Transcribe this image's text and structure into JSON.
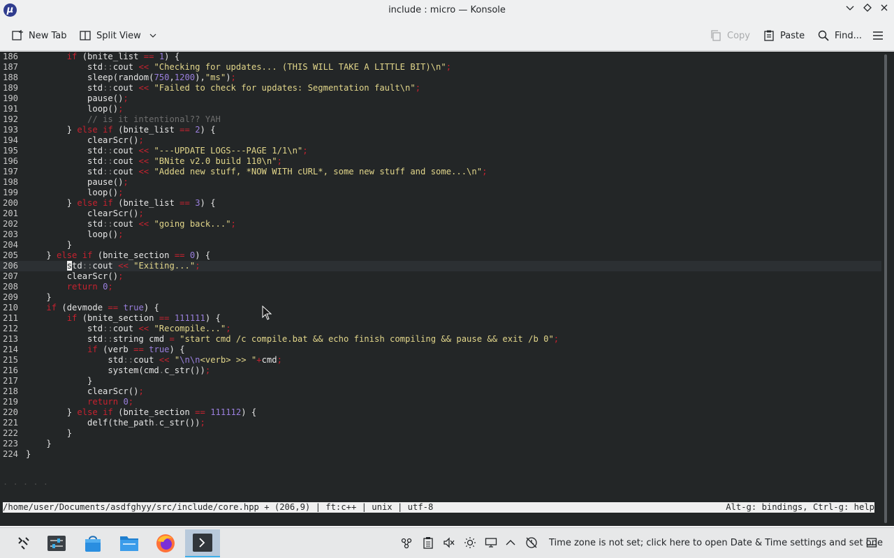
{
  "window": {
    "title": "include : micro — Konsole",
    "app_icon_glyph": "µ",
    "controls": [
      "chevron-down-icon",
      "diamond-icon",
      "close-icon"
    ]
  },
  "toolbar": {
    "new_tab": "New Tab",
    "split_view": "Split View",
    "copy": "Copy",
    "paste": "Paste",
    "find": "Find...",
    "menu_icon": "hamburger-icon"
  },
  "editor": {
    "cursor_line": 206,
    "lines": [
      {
        "n": "186",
        "html": "        <span class='kw'>if</span> (bnite_list <span class='op'>==</span> <span class='num'>1</span>) {"
      },
      {
        "n": "187",
        "html": "            std<span class='ns'>::</span>cout <span class='op'>&lt;&lt;</span> <span class='str'>\"Checking for updates... (THIS WILL TAKE A LITTLE BIT)\\n\"</span><span class='op'>;</span>"
      },
      {
        "n": "188",
        "html": "            sleep(random(<span class='num'>750</span>,<span class='num'>1200</span>),<span class='str'>\"ms\"</span>)<span class='op'>;</span>"
      },
      {
        "n": "189",
        "html": "            std<span class='ns'>::</span>cout <span class='op'>&lt;&lt;</span> <span class='str'>\"Failed to check for updates: Segmentation fault\\n\"</span><span class='op'>;</span>"
      },
      {
        "n": "190",
        "html": "            pause()<span class='op'>;</span>"
      },
      {
        "n": "191",
        "html": "            loop()<span class='op'>;</span>"
      },
      {
        "n": "192",
        "html": "            <span class='cm'>// is it intentional?? YAH</span>"
      },
      {
        "n": "193",
        "html": "        } <span class='kw'>else</span> <span class='kw'>if</span> (bnite_list <span class='op'>==</span> <span class='num'>2</span>) {"
      },
      {
        "n": "194",
        "html": "            clearScr()<span class='op'>;</span>"
      },
      {
        "n": "195",
        "html": "            std<span class='ns'>::</span>cout <span class='op'>&lt;&lt;</span> <span class='str'>\"---UPDATE LOGS---PAGE 1/1\\n\"</span><span class='op'>;</span>"
      },
      {
        "n": "196",
        "html": "            std<span class='ns'>::</span>cout <span class='op'>&lt;&lt;</span> <span class='str'>\"BNite v2.0 build 110\\n\"</span><span class='op'>;</span>"
      },
      {
        "n": "197",
        "html": "            std<span class='ns'>::</span>cout <span class='op'>&lt;&lt;</span> <span class='str'>\"Added new stuff, *NOW WITH cURL*, some new stuff and some...\\n\"</span><span class='op'>;</span>"
      },
      {
        "n": "198",
        "html": "            pause()<span class='op'>;</span>"
      },
      {
        "n": "199",
        "html": "            loop()<span class='op'>;</span>"
      },
      {
        "n": "200",
        "html": "        } <span class='kw'>else</span> <span class='kw'>if</span> (bnite_list <span class='op'>==</span> <span class='num'>3</span>) {"
      },
      {
        "n": "201",
        "html": "            clearScr()<span class='op'>;</span>"
      },
      {
        "n": "202",
        "html": "            std<span class='ns'>::</span>cout <span class='op'>&lt;&lt;</span> <span class='str'>\"going back...\"</span><span class='op'>;</span>"
      },
      {
        "n": "203",
        "html": "            loop()<span class='op'>;</span>"
      },
      {
        "n": "204",
        "html": "        }"
      },
      {
        "n": "205",
        "html": "    } <span class='kw'>else</span> <span class='kw'>if</span> (bnite_section <span class='op'>==</span> <span class='num'>0</span>) {"
      },
      {
        "n": "206",
        "html": "        <span class='cursor'>s</span>td<span class='ns'>::</span>cout <span class='op'>&lt;&lt;</span> <span class='str'>\"Exiting...\"</span><span class='op'>;</span>"
      },
      {
        "n": "207",
        "html": "        clearScr()<span class='op'>;</span>"
      },
      {
        "n": "208",
        "html": "        <span class='kw'>return</span> <span class='num'>0</span><span class='op'>;</span>"
      },
      {
        "n": "209",
        "html": "    }"
      },
      {
        "n": "210",
        "html": "    <span class='kw'>if</span> (devmode <span class='op'>==</span> <span class='num'>true</span>) {"
      },
      {
        "n": "211",
        "html": "        <span class='kw'>if</span> (bnite_section <span class='op'>==</span> <span class='num'>111111</span>) {"
      },
      {
        "n": "212",
        "html": "            std<span class='ns'>::</span>cout <span class='op'>&lt;&lt;</span> <span class='str'>\"Recompile...\"</span><span class='op'>;</span>"
      },
      {
        "n": "213",
        "html": "            std<span class='ns'>::</span>string cmd <span class='op'>=</span> <span class='str'>\"start cmd /c compile.bat &amp;&amp; echo finish compiling &amp;&amp; pause &amp;&amp; exit /b 0\"</span><span class='op'>;</span>"
      },
      {
        "n": "214",
        "html": "            <span class='kw'>if</span> (verb <span class='op'>==</span> <span class='num'>true</span>) {"
      },
      {
        "n": "215",
        "html": "                std<span class='ns'>::</span>cout <span class='op'>&lt;&lt;</span> <span class='str'>\"<span class='num'>\\n\\n</span>&lt;verb&gt; &gt;&gt; \"</span><span class='op'>+</span>cmd<span class='op'>;</span>"
      },
      {
        "n": "216",
        "html": "                system(cmd<span class='ns'>.</span>c_str())<span class='op'>;</span>"
      },
      {
        "n": "217",
        "html": "            }"
      },
      {
        "n": "218",
        "html": "            clearScr()<span class='op'>;</span>"
      },
      {
        "n": "219",
        "html": "            <span class='kw'>return</span> <span class='num'>0</span><span class='op'>;</span>"
      },
      {
        "n": "220",
        "html": "        } <span class='kw'>else</span> <span class='kw'>if</span> (bnite_section <span class='op'>==</span> <span class='num'>111112</span>) {"
      },
      {
        "n": "221",
        "html": "            delf(the_path<span class='ns'>.</span>c_str())<span class='op'>;</span>"
      },
      {
        "n": "222",
        "html": "        }"
      },
      {
        "n": "223",
        "html": "    }"
      },
      {
        "n": "224",
        "html": "}"
      }
    ]
  },
  "statusbar": {
    "left": "/home/user/Documents/asdfghyy/src/include/core.hpp + (206,9) | ft:c++ | unix | utf-8",
    "right": "Alt-g: bindings, Ctrl-g: help"
  },
  "taskbar": {
    "apps": [
      "application-launcher-icon",
      "system-settings-icon",
      "discover-store-icon",
      "dolphin-folder-icon",
      "firefox-icon",
      "konsole-icon"
    ],
    "tray_icons": [
      "kde-connect-icon",
      "clipboard-icon",
      "volume-muted-icon",
      "brightness-icon",
      "display-icon",
      "chevron-up-icon",
      "clock-icon"
    ],
    "clock_text": "Time zone is not set; click here to open Date & Time settings and set one"
  }
}
